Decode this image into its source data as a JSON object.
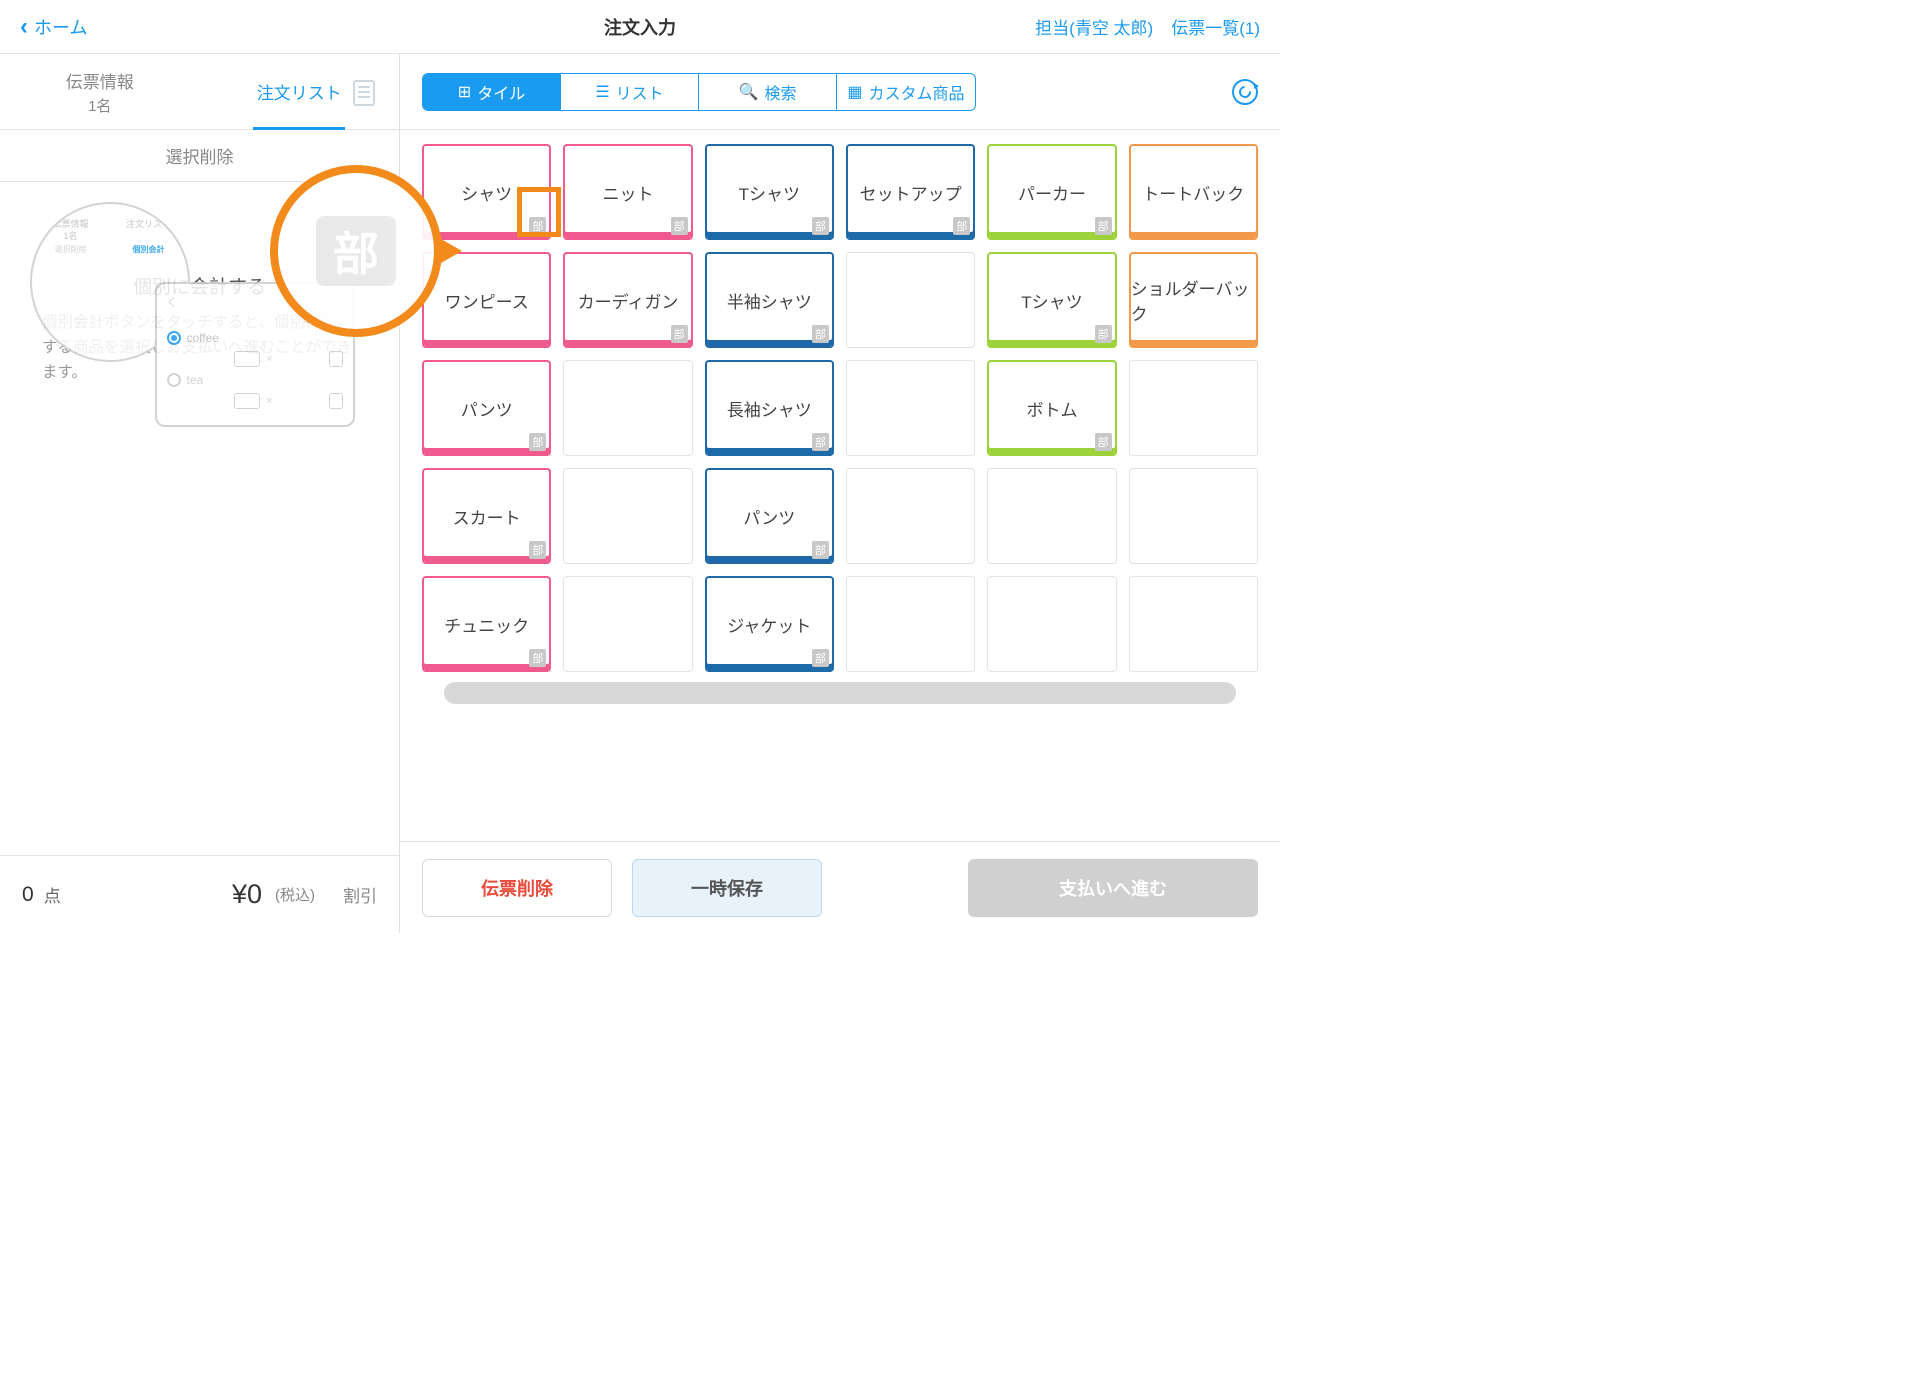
{
  "header": {
    "back": "ホーム",
    "title": "注文入力",
    "staff": "担当(青空 太郎)",
    "slips": "伝票一覧(1)"
  },
  "sidebar": {
    "tab1_l1": "伝票情報",
    "tab1_l2": "1名",
    "tab2": "注文リスト",
    "action_delete": "選択削除",
    "callout_badge": "部",
    "mini": {
      "t1a": "伝票情報",
      "t1b": "1名",
      "t2": "注文リスト",
      "r1": "選択削除",
      "r2": "個別会計",
      "coffee": "ffee",
      "panel_title": "個別会計",
      "item1": "coffee",
      "item2": "tea",
      "back": "く"
    },
    "help_title": "個別に会計する",
    "help_text": "個別会計ボタンをタッチすると、個別に会計する商品を選択しお支払いへ進むことができます。",
    "count_val": "0",
    "count_label": "点",
    "total": "¥0",
    "tax": "(税込)",
    "discount": "割引"
  },
  "toolbar": {
    "tile": "タイル",
    "list": "リスト",
    "search": "検索",
    "custom": "カスタム商品"
  },
  "corner": "部",
  "tiles": [
    [
      {
        "t": "シャツ",
        "c": "pink",
        "b": 1
      },
      {
        "t": "ニット",
        "c": "pink",
        "b": 1
      },
      {
        "t": "Tシャツ",
        "c": "blue",
        "b": 1
      },
      {
        "t": "セットアップ",
        "c": "blue",
        "b": 1
      },
      {
        "t": "パーカー",
        "c": "green",
        "b": 1
      },
      {
        "t": "トートバック",
        "c": "orange",
        "b": 0
      }
    ],
    [
      {
        "t": "ワンピース",
        "c": "pink",
        "b": 0
      },
      {
        "t": "カーディガン",
        "c": "pink",
        "b": 1
      },
      {
        "t": "半袖シャツ",
        "c": "blue",
        "b": 1
      },
      {
        "t": "",
        "c": "empty",
        "b": 0
      },
      {
        "t": "Tシャツ",
        "c": "green",
        "b": 1
      },
      {
        "t": "ショルダーバック",
        "c": "orange",
        "b": 0
      }
    ],
    [
      {
        "t": "パンツ",
        "c": "pink",
        "b": 1
      },
      {
        "t": "",
        "c": "empty",
        "b": 0
      },
      {
        "t": "長袖シャツ",
        "c": "blue",
        "b": 1
      },
      {
        "t": "",
        "c": "empty",
        "b": 0
      },
      {
        "t": "ボトム",
        "c": "green",
        "b": 1
      },
      {
        "t": "",
        "c": "empty",
        "b": 0
      }
    ],
    [
      {
        "t": "スカート",
        "c": "pink",
        "b": 1
      },
      {
        "t": "",
        "c": "empty",
        "b": 0
      },
      {
        "t": "パンツ",
        "c": "blue",
        "b": 1
      },
      {
        "t": "",
        "c": "empty",
        "b": 0
      },
      {
        "t": "",
        "c": "empty",
        "b": 0
      },
      {
        "t": "",
        "c": "empty",
        "b": 0
      }
    ],
    [
      {
        "t": "チュニック",
        "c": "pink",
        "b": 1
      },
      {
        "t": "",
        "c": "empty",
        "b": 0
      },
      {
        "t": "ジャケット",
        "c": "blue",
        "b": 1
      },
      {
        "t": "",
        "c": "empty",
        "b": 0
      },
      {
        "t": "",
        "c": "empty",
        "b": 0
      },
      {
        "t": "",
        "c": "empty",
        "b": 0
      }
    ]
  ],
  "bottom": {
    "delete": "伝票削除",
    "save": "一時保存",
    "pay": "支払いへ進む"
  }
}
